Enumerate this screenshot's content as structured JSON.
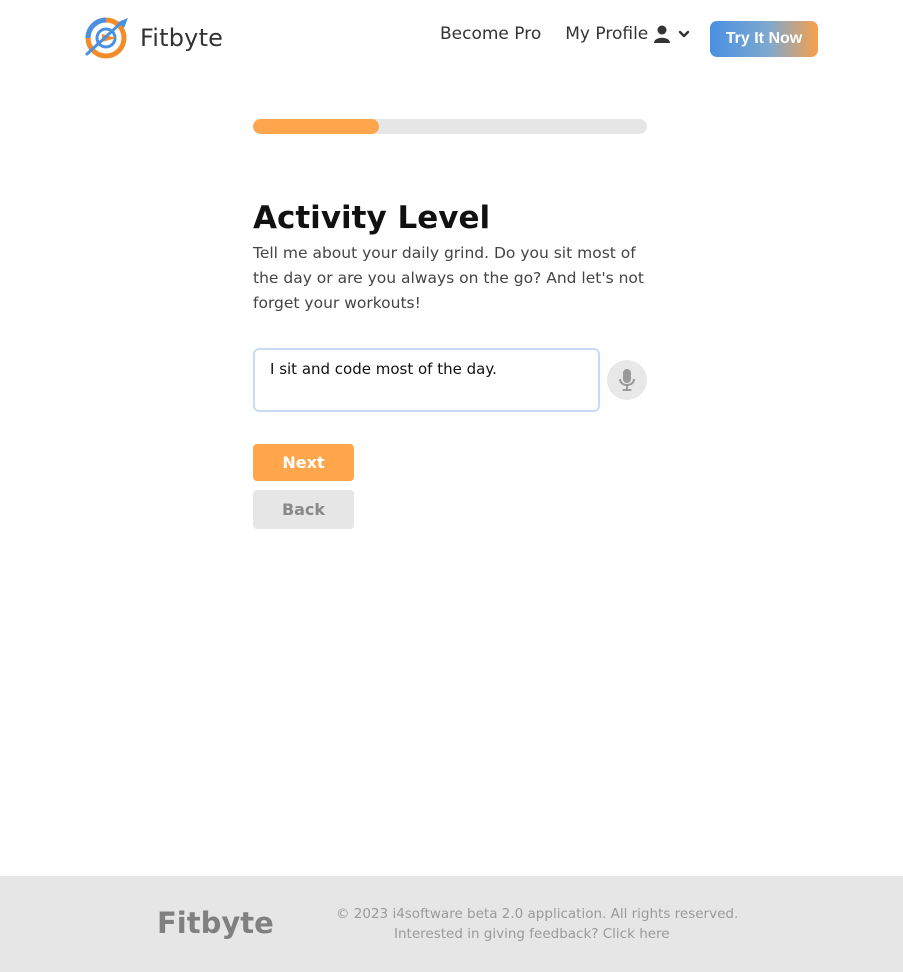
{
  "header": {
    "brand_name": "Fitbyte",
    "nav": {
      "become_pro": "Become Pro",
      "my_profile": "My Profile"
    },
    "cta": "Try It Now"
  },
  "progress": {
    "fraction": 0.32
  },
  "step": {
    "title": "Activity Level",
    "description": "Tell me about your daily grind. Do you sit most of the day or are you always on the go? And let's not forget your workouts!",
    "answer_value": "I sit and code most of the day."
  },
  "actions": {
    "next": "Next",
    "back": "Back"
  },
  "footer": {
    "brand": "Fitbyte",
    "copyright": "© 2023 i4software beta 2.0 application. All rights reserved.",
    "feedback": "Interested in giving feedback? Click here"
  },
  "icons": {
    "logo": "fitbyte-logo-icon",
    "profile": "user-icon",
    "dropdown": "chevron-down-icon",
    "mic": "microphone-icon"
  },
  "colors": {
    "accent_orange": "#ffa64d",
    "track_gray": "#e6e6e6",
    "cta_blue": "#4a90e2"
  }
}
